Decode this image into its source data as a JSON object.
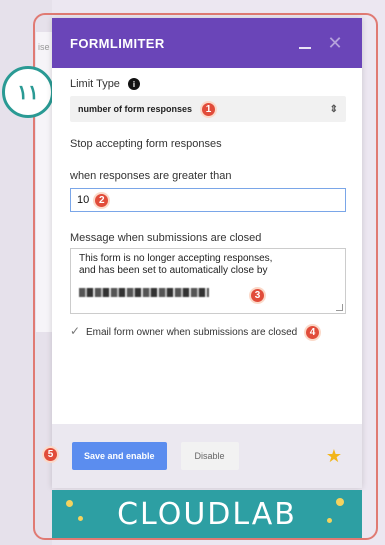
{
  "background": {
    "partial_text": "ise"
  },
  "step_badge": {
    "label": "١١"
  },
  "dialog": {
    "title": "FORMLIMITER",
    "minimize_label": "_",
    "close_label": "✕"
  },
  "limit_type": {
    "label": "Limit Type",
    "info_icon": "i",
    "selected": "number of form responses",
    "marker": "1"
  },
  "stop_text": "Stop accepting form responses",
  "threshold": {
    "label": "when responses are greater than",
    "value": "10",
    "marker": "2"
  },
  "message": {
    "label": "Message when submissions are closed",
    "line1": "This form is no longer accepting responses,",
    "line2": "and has been set to automatically close by",
    "marker": "3"
  },
  "email_owner": {
    "label": "Email form owner when submissions are closed",
    "checked": true,
    "marker": "4"
  },
  "footer": {
    "save_label": "Save and enable",
    "disable_label": "Disable",
    "marker": "5"
  },
  "banner": {
    "text": "CLOUDLAB"
  },
  "colors": {
    "header": "#6a45b8",
    "save_button": "#5b8def",
    "marker": "#e14c3a",
    "frame": "#e07a73",
    "badge": "#2a9a94",
    "banner": "#2d9fa3"
  }
}
